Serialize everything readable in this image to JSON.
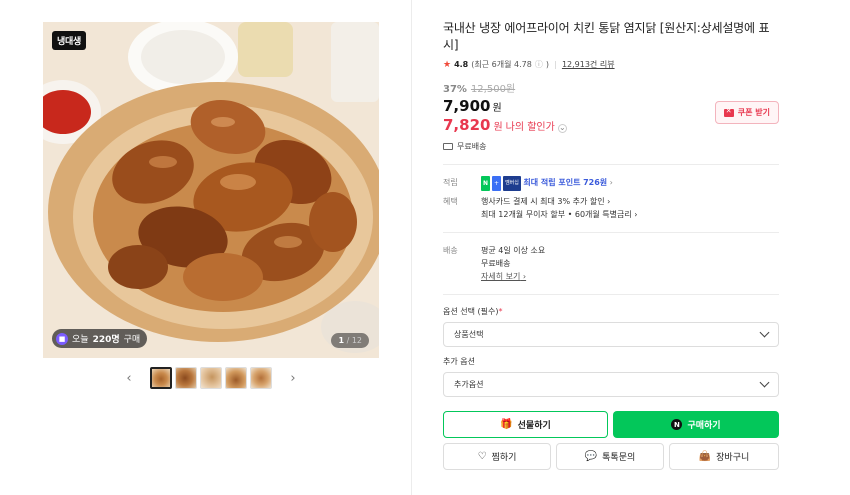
{
  "gallery": {
    "brand_badge": "냉대생",
    "today_badge": {
      "prefix": "오늘",
      "count": "220명",
      "suffix": "구매"
    },
    "page_counter": {
      "current": "1",
      "total": "12"
    },
    "prev_arrow": "‹",
    "next_arrow": "›",
    "thumbnail_count": 5
  },
  "product": {
    "title": "국내산 냉장 에어프라이어 치킨 통닭 염지닭 [원산지:상세설명에 표시]",
    "rating": {
      "score": "4.8",
      "recent": "(최근 6개월 4.78",
      "reviews": "12,913건 리뷰"
    },
    "discount_pct": "37%",
    "original_price": "12,500원",
    "price": "7,900",
    "price_unit": "원",
    "my_price": "7,820",
    "my_price_unit": "원",
    "my_price_label": "나의 할인가",
    "coupon_button": "쿠폰 받기",
    "shipping": "무료배송"
  },
  "details": {
    "points_label": "적립",
    "points_badge_n": "N",
    "points_badge_plus": "+",
    "points_badge_member": "멤버십",
    "points_text": "최대 적립 포인트",
    "points_value": "726원",
    "benefit_label": "혜택",
    "benefit_line1": "행사카드 결제 시 최대 3% 추가 할인",
    "benefit_line2": "최대 12개월 무이자 할부 • 60개월 특별금리",
    "delivery_label": "배송",
    "delivery_line1": "평균 4일 이상 소요",
    "delivery_line2": "무료배송",
    "delivery_more": "자세히 보기"
  },
  "options": {
    "required_label": "옵션 선택",
    "required_suffix": "(필수)",
    "required_mark": "*",
    "required_placeholder": "상품선택",
    "extra_label": "추가 옵션",
    "extra_placeholder": "추가옵션"
  },
  "actions": {
    "gift": "선물하기",
    "buy": "구매하기",
    "buy_icon": "N",
    "wish": "찜하기",
    "talk": "톡톡문의",
    "cart": "장바구니"
  },
  "colors": {
    "naver_green": "#03c75a",
    "sale_red": "#e8384f",
    "point_blue": "#3b5bdb"
  }
}
